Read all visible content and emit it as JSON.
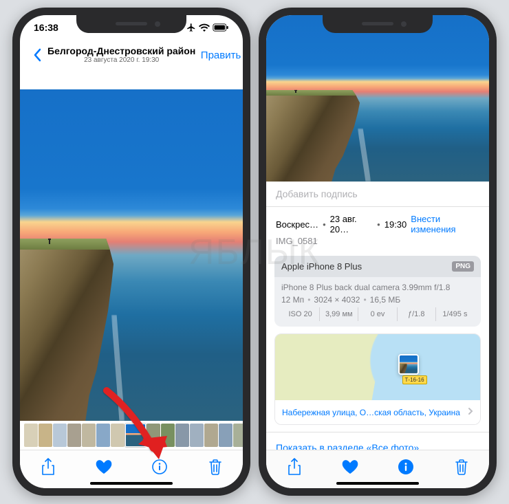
{
  "watermark": "ЯБЛЫК",
  "left": {
    "status": {
      "time": "16:38"
    },
    "nav": {
      "title": "Белгород-Днестровский район",
      "subtitle": "23 августа 2020 г.  19:30",
      "edit": "Править"
    },
    "thumbs": [
      "#d8d0b8",
      "#c8b488",
      "#b8c8d8",
      "#a8a090",
      "#c0b8a0",
      "#88a8c8",
      "#d0c8b0",
      "#2090d0",
      "#909878",
      "#789060",
      "#8898a8",
      "#a0b0c0",
      "#b0a890",
      "#88a0b8",
      "#a8b098"
    ],
    "arrow_target": "info"
  },
  "right": {
    "caption_placeholder": "Добавить подпись",
    "date": {
      "weekday": "Воскрес…",
      "day": "23 авг. 20…",
      "time": "19:30",
      "change": "Внести изменения"
    },
    "filename": "IMG_0581",
    "camera": {
      "device": "Apple iPhone 8 Plus",
      "format_badge": "PNG",
      "lens": "iPhone 8 Plus back dual camera 3.99mm f/1.8",
      "mp": "12 Мп",
      "res": "3024 × 4032",
      "size": "16,5 МБ",
      "exif": {
        "iso": "ISO 20",
        "focal": "3,99 мм",
        "ev": "0 ev",
        "ap": "ƒ/1.8",
        "shutter": "1/495 s"
      }
    },
    "map": {
      "road_label": "Т-16-16",
      "address": "Набережная улица, О…ская область, Украина"
    },
    "show_all": "Показать в разделе «Все фото»"
  }
}
